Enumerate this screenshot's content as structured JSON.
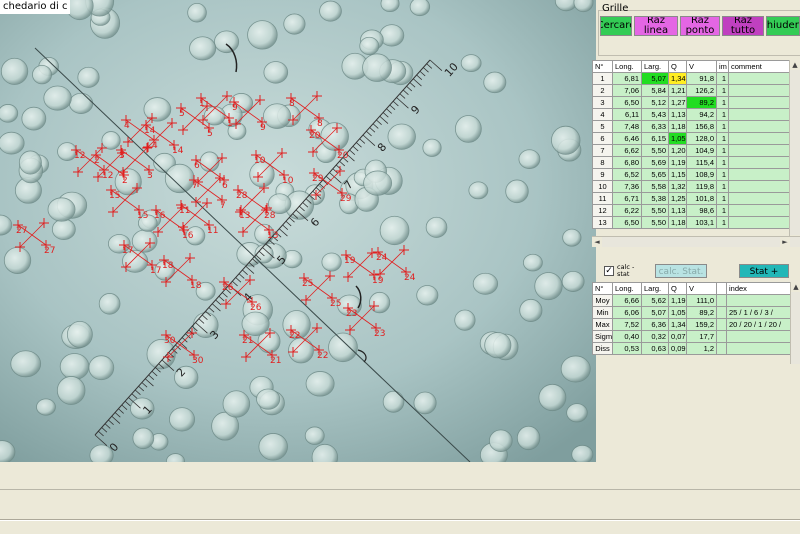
{
  "window": {
    "title_fragment": "chedario di c"
  },
  "panel": {
    "group_label": "Grille",
    "buttons": [
      {
        "label": "Cercare",
        "color": "#33cc55"
      },
      {
        "label": "Raz linea",
        "color": "#e466e4"
      },
      {
        "label": "Raz ponto",
        "color": "#e466e4"
      },
      {
        "label": "Raz tutto",
        "color": "#c040c0"
      },
      {
        "label": "chiudere",
        "color": "#33cc55"
      }
    ]
  },
  "measure_table": {
    "headers": [
      "N°",
      "Long.",
      "Larg.",
      "Q",
      "V",
      "im",
      "comment"
    ],
    "rows": [
      [
        "1",
        "6,81",
        "5,07",
        "1,34",
        "91,8",
        "1",
        ""
      ],
      [
        "2",
        "7,06",
        "5,84",
        "1,21",
        "126,2",
        "1",
        ""
      ],
      [
        "3",
        "6,50",
        "5,12",
        "1,27",
        "89,2",
        "1",
        ""
      ],
      [
        "4",
        "6,11",
        "5,43",
        "1,13",
        "94,2",
        "1",
        ""
      ],
      [
        "5",
        "7,48",
        "6,33",
        "1,18",
        "156,8",
        "1",
        ""
      ],
      [
        "6",
        "6,46",
        "6,15",
        "1,05",
        "128,0",
        "1",
        ""
      ],
      [
        "7",
        "6,62",
        "5,50",
        "1,20",
        "104,9",
        "1",
        ""
      ],
      [
        "8",
        "6,80",
        "5,69",
        "1,19",
        "115,4",
        "1",
        ""
      ],
      [
        "9",
        "6,52",
        "5,65",
        "1,15",
        "108,9",
        "1",
        ""
      ],
      [
        "10",
        "7,36",
        "5,58",
        "1,32",
        "119,8",
        "1",
        ""
      ],
      [
        "11",
        "6,71",
        "5,38",
        "1,25",
        "101,8",
        "1",
        ""
      ],
      [
        "12",
        "6,22",
        "5,50",
        "1,13",
        "98,6",
        "1",
        ""
      ],
      [
        "13",
        "6,50",
        "5,50",
        "1,18",
        "103,1",
        "1",
        ""
      ]
    ],
    "highlight_colors": {
      "min": "#22dd22",
      "max": "#ffee22",
      "row": "#c8f0c8"
    }
  },
  "controls": {
    "calc_stat_checkbox_label": "calc - stat",
    "calc_stat_checked": "✓",
    "calc_stat_button": "calc. Stat.",
    "stat_plus_button": "Stat +"
  },
  "stats_table": {
    "headers": [
      "N°",
      "Long.",
      "Larg.",
      "Q",
      "V",
      "",
      "index"
    ],
    "rows": [
      [
        "Moy",
        "6,66",
        "5,62",
        "1,19",
        "111,0",
        "",
        ""
      ],
      [
        "Min",
        "6,06",
        "5,07",
        "1,05",
        "89,2",
        "",
        "25 / 1 / 6 / 3 /"
      ],
      [
        "Max",
        "7,52",
        "6,36",
        "1,34",
        "159,2",
        "",
        "20 / 20 / 1 / 20 /"
      ],
      [
        "Sigm",
        "0,40",
        "0,32",
        "0,07",
        "17,7",
        "",
        ""
      ],
      [
        "Diss",
        "0,53",
        "0,63",
        "0,09",
        "1,2",
        "",
        ""
      ]
    ]
  },
  "image": {
    "ruler_labels": [
      "0",
      "1",
      "2",
      "3",
      "4",
      "5",
      "6",
      "7",
      "8",
      "9",
      "10"
    ],
    "spore_labels": [
      "1",
      "2",
      "3",
      "4",
      "5",
      "6",
      "7",
      "8",
      "9",
      "10",
      "11",
      "12",
      "13",
      "14",
      "15",
      "16",
      "17",
      "18",
      "19",
      "20",
      "21",
      "22",
      "23",
      "24",
      "25",
      "26",
      "27",
      "28",
      "29",
      "30"
    ]
  }
}
